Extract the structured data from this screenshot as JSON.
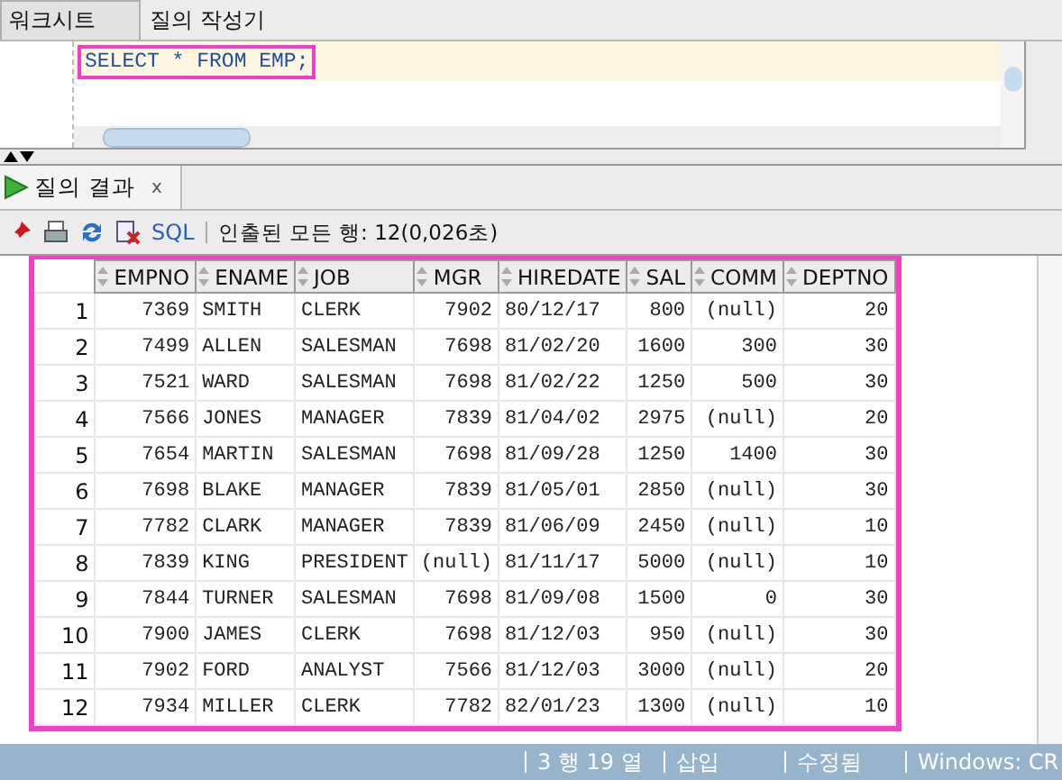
{
  "tabs": [
    {
      "label": "워크시트",
      "selected": true
    },
    {
      "label": "질의 작성기",
      "selected": false
    }
  ],
  "editor": {
    "code": "SELECT * FROM EMP;",
    "highlighted": true
  },
  "result_tab": {
    "label": "질의 결과",
    "close": "x"
  },
  "toolbar": {
    "sql_link": "SQL",
    "status": "인출된 모든 행: 12(0,026초)"
  },
  "table": {
    "highlighted": true,
    "columns": [
      {
        "label": "EMPNO",
        "kind": "number"
      },
      {
        "label": "ENAME",
        "kind": "text"
      },
      {
        "label": "JOB",
        "kind": "text"
      },
      {
        "label": "MGR",
        "kind": "number"
      },
      {
        "label": "HIREDATE",
        "kind": "text"
      },
      {
        "label": "SAL",
        "kind": "number"
      },
      {
        "label": "COMM",
        "kind": "number"
      },
      {
        "label": "DEPTNO",
        "kind": "number"
      }
    ],
    "rows": [
      {
        "row_number": "1",
        "cells": [
          "7369",
          "SMITH",
          "CLERK",
          "7902",
          "80/12/17",
          "800",
          "(null)",
          "20"
        ]
      },
      {
        "row_number": "2",
        "cells": [
          "7499",
          "ALLEN",
          "SALESMAN",
          "7698",
          "81/02/20",
          "1600",
          "300",
          "30"
        ]
      },
      {
        "row_number": "3",
        "cells": [
          "7521",
          "WARD",
          "SALESMAN",
          "7698",
          "81/02/22",
          "1250",
          "500",
          "30"
        ]
      },
      {
        "row_number": "4",
        "cells": [
          "7566",
          "JONES",
          "MANAGER",
          "7839",
          "81/04/02",
          "2975",
          "(null)",
          "20"
        ]
      },
      {
        "row_number": "5",
        "cells": [
          "7654",
          "MARTIN",
          "SALESMAN",
          "7698",
          "81/09/28",
          "1250",
          "1400",
          "30"
        ]
      },
      {
        "row_number": "6",
        "cells": [
          "7698",
          "BLAKE",
          "MANAGER",
          "7839",
          "81/05/01",
          "2850",
          "(null)",
          "30"
        ]
      },
      {
        "row_number": "7",
        "cells": [
          "7782",
          "CLARK",
          "MANAGER",
          "7839",
          "81/06/09",
          "2450",
          "(null)",
          "10"
        ]
      },
      {
        "row_number": "8",
        "cells": [
          "7839",
          "KING",
          "PRESIDENT",
          "(null)",
          "81/11/17",
          "5000",
          "(null)",
          "10"
        ]
      },
      {
        "row_number": "9",
        "cells": [
          "7844",
          "TURNER",
          "SALESMAN",
          "7698",
          "81/09/08",
          "1500",
          "0",
          "30"
        ]
      },
      {
        "row_number": "10",
        "cells": [
          "7900",
          "JAMES",
          "CLERK",
          "7698",
          "81/12/03",
          "950",
          "(null)",
          "30"
        ]
      },
      {
        "row_number": "11",
        "cells": [
          "7902",
          "FORD",
          "ANALYST",
          "7566",
          "81/12/03",
          "3000",
          "(null)",
          "20"
        ]
      },
      {
        "row_number": "12",
        "cells": [
          "7934",
          "MILLER",
          "CLERK",
          "7782",
          "82/01/23",
          "1300",
          "(null)",
          "10"
        ]
      }
    ]
  },
  "status_bar": [
    "3 행 19 열",
    "삽입",
    "수정됨",
    "Windows: CR"
  ]
}
